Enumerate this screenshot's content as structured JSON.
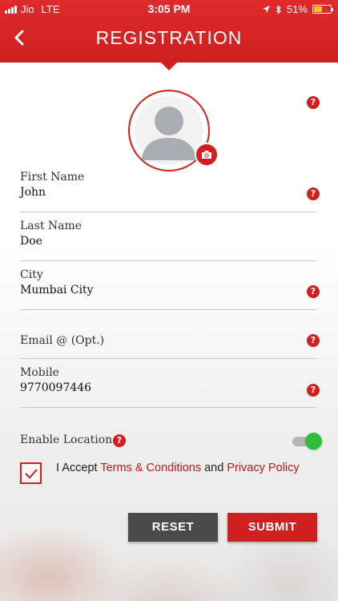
{
  "status_bar": {
    "carrier": "Jio",
    "network": "LTE",
    "time": "3:05 PM",
    "battery": "51%",
    "battery_level": 0.51
  },
  "header": {
    "title": "REGISTRATION",
    "back_icon": "chevron-left-icon",
    "color": "#d01f1f"
  },
  "help_glyph": "?",
  "form": {
    "first_name": {
      "label": "First Name",
      "value": "John"
    },
    "last_name": {
      "label": "Last Name",
      "value": "Doe"
    },
    "city": {
      "label": "City",
      "value": "Mumbai City"
    },
    "email": {
      "label": "Email @ (Opt.)",
      "value": ""
    },
    "mobile": {
      "label": "Mobile",
      "value": "9770097446"
    }
  },
  "location": {
    "label": "Enable Location",
    "enabled": true
  },
  "terms": {
    "checked": true,
    "prefix": "I Accept ",
    "terms_link": "Terms & Conditions",
    "conjunction": " and ",
    "privacy_link": "Privacy Policy"
  },
  "buttons": {
    "reset": "RESET",
    "submit": "SUBMIT"
  },
  "colors": {
    "accent": "#d01f1f",
    "toggle_on": "#2dbd3a",
    "reset_button": "#4a4a4a"
  }
}
